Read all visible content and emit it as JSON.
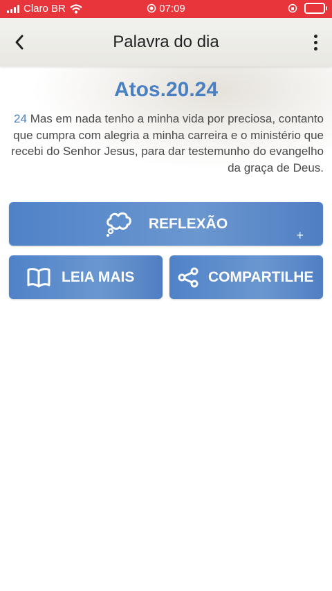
{
  "status_bar": {
    "carrier": "Claro BR",
    "time": "07:09"
  },
  "header": {
    "title": "Palavra do dia"
  },
  "verse": {
    "reference": "Atos.20.24",
    "number": "24",
    "text": "Mas em nada tenho a minha vida por preciosa, contanto que cumpra com alegria a minha carreira e o ministério que recebi do Senhor Jesus, para dar testemunho do evangelho da graça de Deus."
  },
  "buttons": {
    "reflexao": "REFLEXÃO",
    "leia_mais": "LEIA MAIS",
    "compartilhe": "COMPARTILHE"
  },
  "colors": {
    "status_bar": "#e8343b",
    "accent": "#4a7fc1",
    "button": "#5b8bcc"
  }
}
